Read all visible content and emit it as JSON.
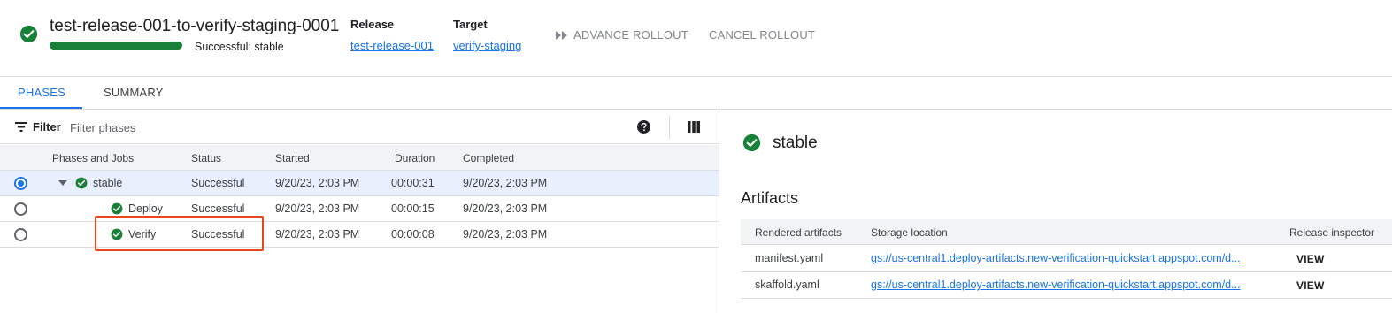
{
  "header": {
    "title": "test-release-001-to-verify-staging-0001",
    "status_text": "Successful: stable",
    "progress_fraction": 1.0,
    "release_label": "Release",
    "release_value": "test-release-001",
    "target_label": "Target",
    "target_value": "verify-staging",
    "advance_button": "ADVANCE ROLLOUT",
    "cancel_button": "CANCEL ROLLOUT"
  },
  "tabs": [
    {
      "label": "PHASES",
      "active": true
    },
    {
      "label": "SUMMARY",
      "active": false
    }
  ],
  "filter": {
    "label": "Filter",
    "placeholder": "Filter phases"
  },
  "phases_table": {
    "columns": [
      "Phases and Jobs",
      "Status",
      "Started",
      "Duration",
      "Completed"
    ],
    "rows": [
      {
        "name": "stable",
        "status": "Successful",
        "started": "9/20/23, 2:03 PM",
        "duration": "00:00:31",
        "completed": "9/20/23, 2:03 PM",
        "selected": true
      },
      {
        "name": "Deploy",
        "status": "Successful",
        "started": "9/20/23, 2:03 PM",
        "duration": "00:00:15",
        "completed": "9/20/23, 2:03 PM",
        "selected": false
      },
      {
        "name": "Verify",
        "status": "Successful",
        "started": "9/20/23, 2:03 PM",
        "duration": "00:00:08",
        "completed": "9/20/23, 2:03 PM",
        "selected": false
      }
    ]
  },
  "detail": {
    "title": "stable",
    "artifacts_heading": "Artifacts",
    "columns": [
      "Rendered artifacts",
      "Storage location",
      "Release inspector"
    ],
    "rows": [
      {
        "name": "manifest.yaml",
        "location": "gs://us-central1.deploy-artifacts.new-verification-quickstart.appspot.com/d...",
        "action": "VIEW"
      },
      {
        "name": "skaffold.yaml",
        "location": "gs://us-central1.deploy-artifacts.new-verification-quickstart.appspot.com/d...",
        "action": "VIEW"
      }
    ]
  },
  "colors": {
    "success": "#188038",
    "accent": "#1a73e8",
    "highlight": "#e8461c"
  },
  "icons": [
    "check-circle-icon",
    "fast-forward-icon",
    "filter-icon",
    "help-icon",
    "columns-icon",
    "caret-down-icon"
  ]
}
